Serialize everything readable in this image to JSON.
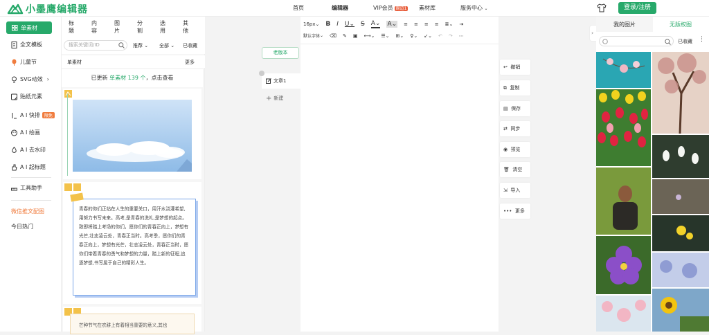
{
  "header": {
    "brand": "小墨鹰编辑器",
    "nav": [
      "首页",
      "编辑器",
      "VIP会员",
      "素材库",
      "服务中心"
    ],
    "vip_badge": "周边1",
    "login": "登录/注册",
    "brand_color": "#27a96a"
  },
  "sidebar": {
    "active": "单素材",
    "items": [
      "全文模板",
      "儿童节",
      "SVG动效",
      "贴纸元素"
    ],
    "ai_items": [
      "A I 快排",
      "A I 绘画",
      "A I 去水印",
      "A I 起标题"
    ],
    "ai_badge": "限免",
    "tools": "工具助手",
    "wechat": "微信推文配图",
    "hot": "今日热门"
  },
  "materials": {
    "tabs": [
      "标题",
      "内容",
      "图片",
      "分割",
      "选用",
      "其他"
    ],
    "search_placeholder": "搜索关键词/ID",
    "filters": [
      "推荐",
      "全部",
      "已收藏"
    ],
    "section_title": "单素材",
    "more": "更多",
    "update_prefix": "已更新",
    "update_link": "单素材 139 个",
    "update_suffix": "，点击查看",
    "card_text": "青春的你们正站在人生的重要关口，用汗水浇灌希望,用努力书写未来。高考,是青春的洗礼,是梦想的起点。致即将踏上考场的你们，愿你们的青春正向上，梦想有光芒,壮志凌云处，青春正当时。高考季，愿你们的青春正向上，梦想有光芒，壮志凌云处，青春正当时，愿你们带着青春的勇气和梦想的力量，踏上新的征程,追逐梦想,书写属于自己的精彩人生。",
    "card2_text": "芒种节气在农耕上有着相当重要的意义,其也"
  },
  "document": {
    "old_version": "老版本",
    "doc_name": "文章1",
    "new_doc": "新建"
  },
  "toolbar": {
    "font_size": "16px",
    "font_family": "默认字体"
  },
  "actions": [
    "撤销",
    "复制",
    "保存",
    "同步",
    "预览",
    "清空",
    "导入",
    "更多"
  ],
  "right_panel": {
    "tabs": [
      "我的图片",
      "无版权图"
    ],
    "collected": "已收藏"
  }
}
